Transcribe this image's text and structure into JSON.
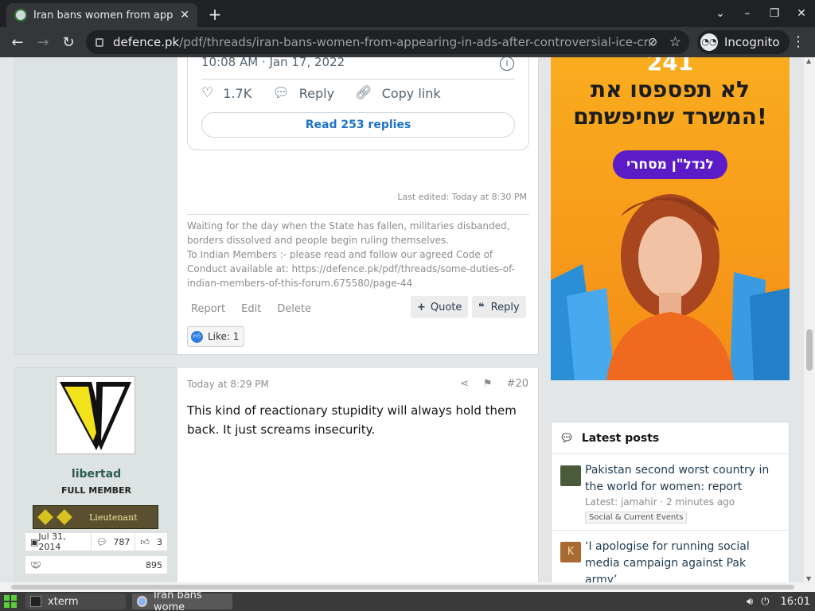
{
  "browser": {
    "tab_title": "Iran bans women from app",
    "new_tab": "+",
    "window_controls": [
      "⌄",
      "–",
      "❐",
      "✕"
    ],
    "url_host": "defence.pk",
    "url_path": "/pdf/threads/iran-bans-women-from-appearing-in-ads-after-controversial-ice-cr...",
    "incognito_label": "Incognito"
  },
  "post1": {
    "tweet": {
      "time": "10:08 AM · Jan 17, 2022",
      "likes": "1.7K",
      "reply_label": "Reply",
      "copy_label": "Copy link",
      "read_replies": "Read 253 replies"
    },
    "last_edited": "Last edited: Today at 8:30 PM",
    "signature": [
      "Waiting for the day when the State has fallen, militaries disbanded, borders dissolved and people begin ruling themselves.",
      "To Indian Members :- please read and follow our agreed Code of Conduct available at: https://defence.pk/pdf/threads/some-duties-of-indian-members-of-this-forum.675580/page-44"
    ],
    "actions": {
      "report": "Report",
      "edit": "Edit",
      "delete": "Delete",
      "quote": "Quote",
      "reply": "Reply"
    },
    "likes": "Like: 1"
  },
  "post2": {
    "username": "libertad",
    "user_title": "FULL MEMBER",
    "rank": "Lieutenant",
    "joined": "Jul 31, 2014",
    "messages": "787",
    "reactions": "3",
    "trophy_points": "895",
    "date": "Today at 8:29 PM",
    "number": "#20",
    "body": "This kind of reactionary stupidity will always hold them back. It just screams insecurity."
  },
  "ad": {
    "top_text": "241",
    "headline_line1": "לא תפספסו את",
    "headline_line2": "המשרד שחיפשתם!",
    "cta": "לנדל\"ן מסחרי"
  },
  "latest_posts": {
    "heading": "Latest posts",
    "items": [
      {
        "title": "Pakistan second worst country in the world for women: report",
        "meta": "Latest: jamahir · 2 minutes ago",
        "forum": "Social & Current Events",
        "avatar_color": "#4a5a3a"
      },
      {
        "title": "‘I apologise for running social media campaign against Pak army’",
        "avatar_letter": "K",
        "avatar_color": "#a86a30"
      }
    ]
  },
  "taskbar": {
    "items": [
      "xterm",
      "Iran bans wome"
    ],
    "clock": "16:01"
  }
}
